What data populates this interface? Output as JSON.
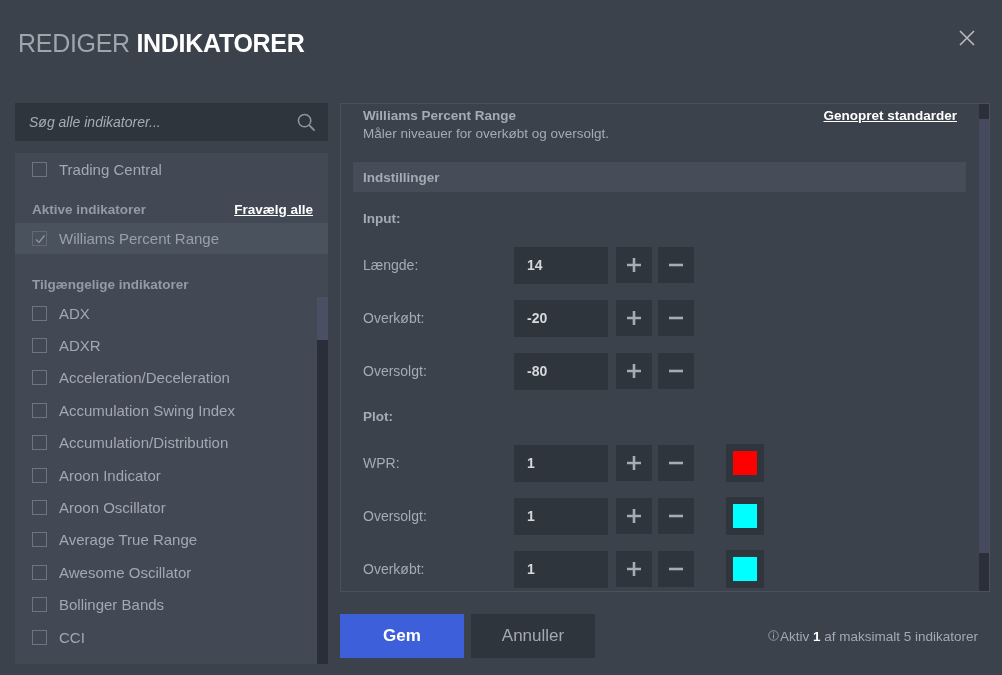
{
  "title": {
    "light": "REDIGER",
    "bold": "INDIKATORER"
  },
  "search": {
    "placeholder": "Søg alle indikatorer..."
  },
  "sidebar": {
    "top_items": [
      {
        "label": "Trading Central",
        "checked": false,
        "selected": false
      }
    ],
    "active_section": {
      "heading": "Aktive indikatorer",
      "action": "Fravælg alle",
      "items": [
        {
          "label": "Williams Percent Range",
          "checked": true,
          "selected": true
        }
      ]
    },
    "available_section": {
      "heading": "Tilgængelige indikatorer",
      "items": [
        {
          "label": "ADX",
          "checked": false
        },
        {
          "label": "ADXR",
          "checked": false
        },
        {
          "label": "Acceleration/Deceleration",
          "checked": false
        },
        {
          "label": "Accumulation Swing Index",
          "checked": false
        },
        {
          "label": "Accumulation/Distribution",
          "checked": false
        },
        {
          "label": "Aroon Indicator",
          "checked": false
        },
        {
          "label": "Aroon Oscillator",
          "checked": false
        },
        {
          "label": "Average True Range",
          "checked": false
        },
        {
          "label": "Awesome Oscillator",
          "checked": false
        },
        {
          "label": "Bollinger Bands",
          "checked": false
        },
        {
          "label": "CCI",
          "checked": false
        }
      ]
    }
  },
  "indicator": {
    "name": "Williams Percent Range",
    "description": "Måler niveauer for overkøbt og oversolgt.",
    "reset_link": "Genopret standarder"
  },
  "settings": {
    "title": "Indstillinger",
    "groups": [
      {
        "heading": "Input:",
        "rows": [
          {
            "label": "Længde:",
            "value": "14"
          },
          {
            "label": "Overkøbt:",
            "value": "-20"
          },
          {
            "label": "Oversolgt:",
            "value": "-80"
          }
        ]
      },
      {
        "heading": "Plot:",
        "rows": [
          {
            "label": "WPR:",
            "value": "1",
            "color": "#ff0000"
          },
          {
            "label": "Oversolgt:",
            "value": "1",
            "color": "#00ffff"
          },
          {
            "label": "Overkøbt:",
            "value": "1",
            "color": "#00ffff"
          }
        ]
      }
    ]
  },
  "buttons": [
    {
      "label": "Gem",
      "kind": "primary"
    },
    {
      "label": "Annuller",
      "kind": "secondary"
    }
  ],
  "status": "Aktiv **1** af maksimalt 5 indikatorer"
}
